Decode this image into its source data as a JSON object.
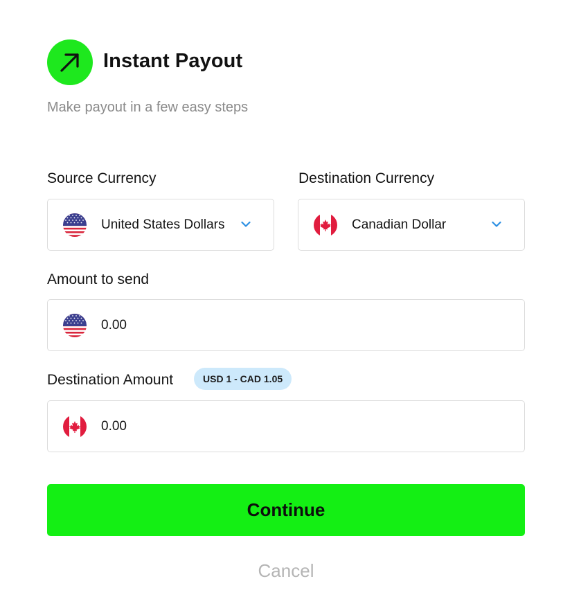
{
  "header": {
    "icon": "arrow-up-right-icon",
    "title": "Instant Payout",
    "subtitle": "Make payout in a few easy steps",
    "accent_color": "#1ee81e"
  },
  "source_currency": {
    "label": "Source Currency",
    "flag": "us-flag-icon",
    "value": "United States Dollars"
  },
  "destination_currency": {
    "label": "Destination Currency",
    "flag": "ca-flag-icon",
    "value": "Canadian Dollar"
  },
  "amount_to_send": {
    "label": "Amount to send",
    "flag": "us-flag-icon",
    "value": "0.00"
  },
  "destination_amount": {
    "label": "Destination Amount",
    "rate_badge": "USD 1 - CAD 1.05",
    "flag": "ca-flag-icon",
    "value": "0.00"
  },
  "actions": {
    "continue_label": "Continue",
    "cancel_label": "Cancel",
    "continue_color": "#14ef14"
  }
}
